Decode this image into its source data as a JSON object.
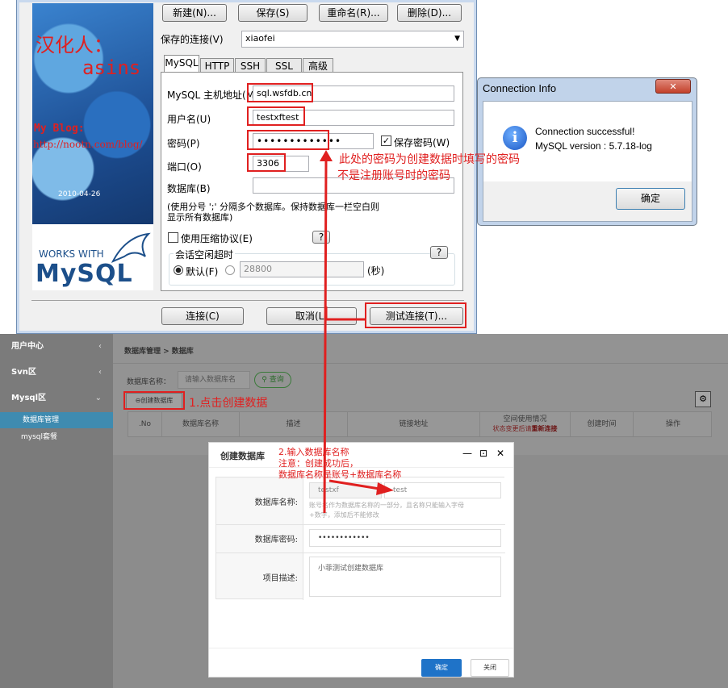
{
  "sqlyog": {
    "buttons": {
      "new": "新建(N)...",
      "save": "保存(S)",
      "rename": "重命名(R)...",
      "delete": "删除(D)..."
    },
    "saved_label": "保存的连接(V)",
    "saved_value": "xiaofei",
    "tabs": [
      "MySQL",
      "HTTP",
      "SSH",
      "SSL",
      "高级"
    ],
    "host_label": "MySQL 主机地址(M)",
    "host_value": "sql.wsfdb.cn",
    "user_label": "用户名(U)",
    "user_value": "testxftest",
    "pwd_label": "密码(P)",
    "pwd_value": "•••••••••••••",
    "save_pwd": "保存密码(W)",
    "port_label": "端口(O)",
    "port_value": "3306",
    "db_label": "数据库(B)",
    "db_hint_1": "(使用分号 ';' 分隔多个数据库。保持数据库一栏空白则",
    "db_hint_2": "显示所有数据库)",
    "compress": "使用压缩协议(E)",
    "help": "?",
    "timeout_legend": "会话空闲超时",
    "default_opt": "默认(F)",
    "timeout_value": "28800",
    "seconds": "(秒)",
    "connect": "连接(C)",
    "cancel": "取消(L)",
    "test": "测试连接(T)...",
    "banner": {
      "han": "汉化人：",
      "asins": "asins",
      "blog": "My Blog:",
      "url": "http://nootn.com/blog/",
      "date": "2010-04-26",
      "works": "WORKS WITH",
      "mysql": "MySQL"
    }
  },
  "annotations": {
    "pwd_note_1": "此处的密码为创建数据时填写的密码",
    "pwd_note_2": "不是注册账号时的密码",
    "step1": "1.点击创建数据",
    "step2_1": "2.输入数据库名称",
    "step2_2": "注意：创建成功后，",
    "step2_3": "数据库名称是账号+数据库名称"
  },
  "conninfo": {
    "title": "Connection Info",
    "line1": "Connection successful!",
    "line2": "MySQL version : 5.7.18-log",
    "ok": "确定",
    "close": "✕"
  },
  "web": {
    "sidebar": [
      {
        "label": "用户中心"
      },
      {
        "label": "Svn区"
      },
      {
        "label": "Mysql区"
      }
    ],
    "sub": [
      "数据库管理",
      "mysql套餐"
    ],
    "breadcrumb": "数据库管理 > 数据库",
    "search_label": "数据库名称：",
    "search_placeholder": "请输入数据库名",
    "query": "查询",
    "create": "创建数据库",
    "headers": [
      ".No",
      "数据库名称",
      "描述",
      "链接地址",
      "空间使用情况",
      "创建时间",
      "操作"
    ],
    "usage_sub": "状态变更后请",
    "usage_link": "重新连接"
  },
  "modal": {
    "title": "创建数据库",
    "name_label": "数据库名称:",
    "prefix": "testxf",
    "name_value": "test",
    "hint_1": "账号名作为数据库名称的一部分，且名称只能输入字母",
    "hint_2": "+数字，添加后不能修改",
    "pwd_label": "数据库密码:",
    "pwd_value": "••••••••••••",
    "desc_label": "项目描述:",
    "desc_value": "小菲测试创建数据库",
    "ok": "确定",
    "close": "关闭"
  },
  "colors": {
    "red": "#e02020",
    "blue": "#1f73c8",
    "accent_teal": "#3aa0c8"
  }
}
